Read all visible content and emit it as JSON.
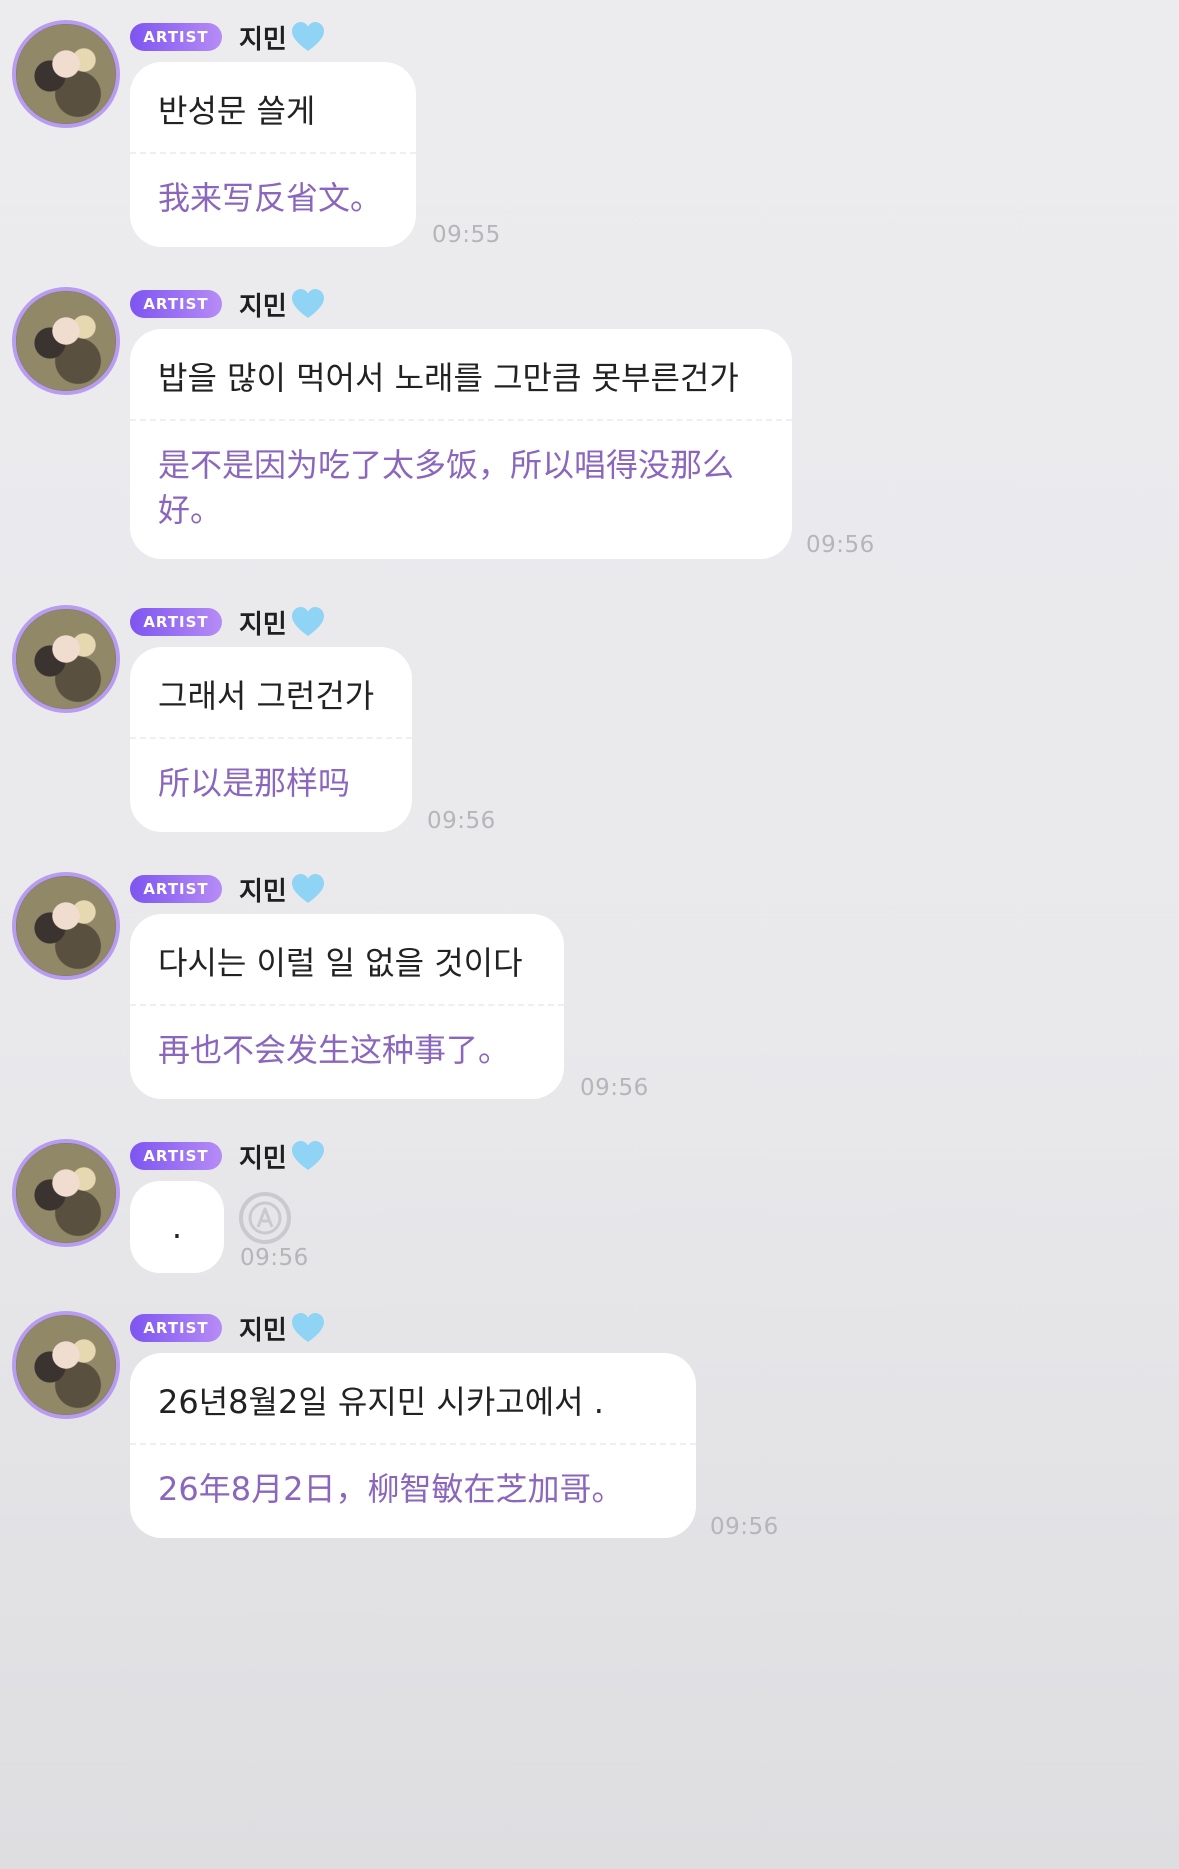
{
  "messages": [
    {
      "badge": "ARTIST",
      "name": "지민",
      "korean": "반성문 쓸게",
      "chinese": "我来写反省文。",
      "time": "09:55"
    },
    {
      "badge": "ARTIST",
      "name": "지민",
      "korean": "밥을 많이 먹어서 노래를 그만큼 못부른건가",
      "chinese": "是不是因为吃了太多饭，所以唱得没那么好。",
      "time": "09:56"
    },
    {
      "badge": "ARTIST",
      "name": "지민",
      "korean": "그래서 그런건가",
      "chinese": "所以是那样吗",
      "time": "09:56"
    },
    {
      "badge": "ARTIST",
      "name": "지민",
      "korean": "다시는 이럴 일 없을 것이다",
      "chinese": "再也不会发生这种事了。",
      "time": "09:56"
    },
    {
      "badge": "ARTIST",
      "name": "지민",
      "korean": ".",
      "time": "09:56"
    },
    {
      "badge": "ARTIST",
      "name": "지민",
      "korean": "26년8월2일 유지민 시카고에서 .",
      "chinese": "26年8月2日，柳智敏在芝加哥。",
      "time": "09:56"
    }
  ],
  "icons": {
    "heart": "light-blue-heart-icon",
    "translate": "translate-icon"
  },
  "colors": {
    "badge_start": "#7d55f0",
    "badge_end": "#b68cf6",
    "translation_text": "#8b66bd",
    "heart": "#8fd3f5"
  }
}
